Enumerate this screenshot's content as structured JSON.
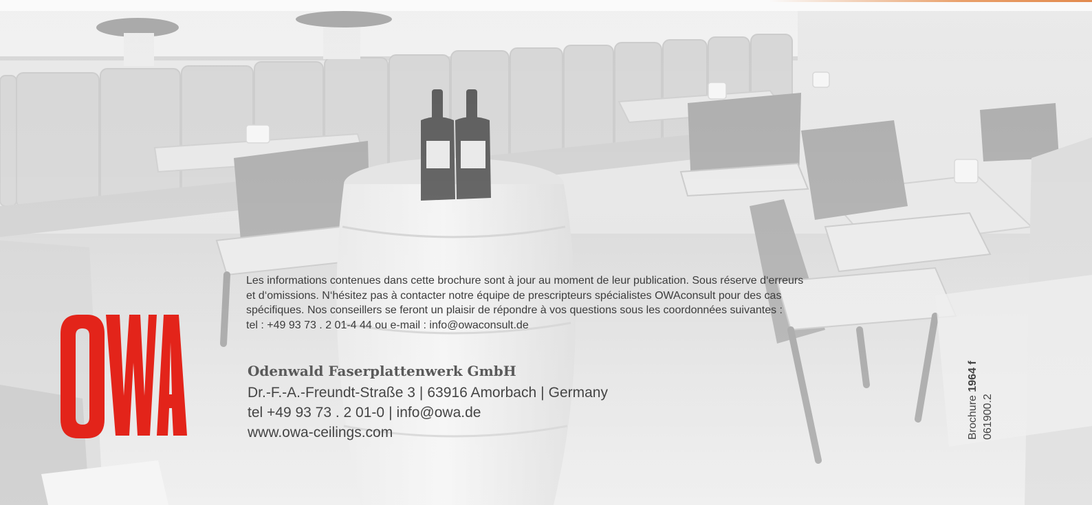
{
  "logo": {
    "text": "OWA",
    "color": "#e3241a"
  },
  "disclaimer": {
    "lines": [
      "Les informations contenues dans cette brochure sont à jour au moment de leur publication. Sous réserve d‘erreurs",
      "et d‘omissions. N‘hésitez pas à contacter notre équipe de prescripteurs spécialistes OWAconsult pour des cas",
      "spécifiques. Nos conseillers se feront un plaisir de répondre à vos questions sous les coordonnées suivantes :",
      "tel : +49 93 73 . 2 01-4 44 ou e-mail : info@owaconsult.de"
    ]
  },
  "company": {
    "name": "Odenwald Faserplattenwerk GmbH",
    "street": "Dr.-F.-A.-Freundt-Straße 3",
    "city": "63916 Amorbach",
    "country": "Germany",
    "phone": "tel +49 93 73 . 2 01-0",
    "email": "info@owa.de",
    "website": "www.owa-ceilings.com",
    "separator": "|"
  },
  "brochure": {
    "label": "Brochure",
    "number": "1964 f",
    "code": "061900.2"
  },
  "colors": {
    "brand_red": "#e3241a",
    "accent_orange": "#e28a4e"
  }
}
